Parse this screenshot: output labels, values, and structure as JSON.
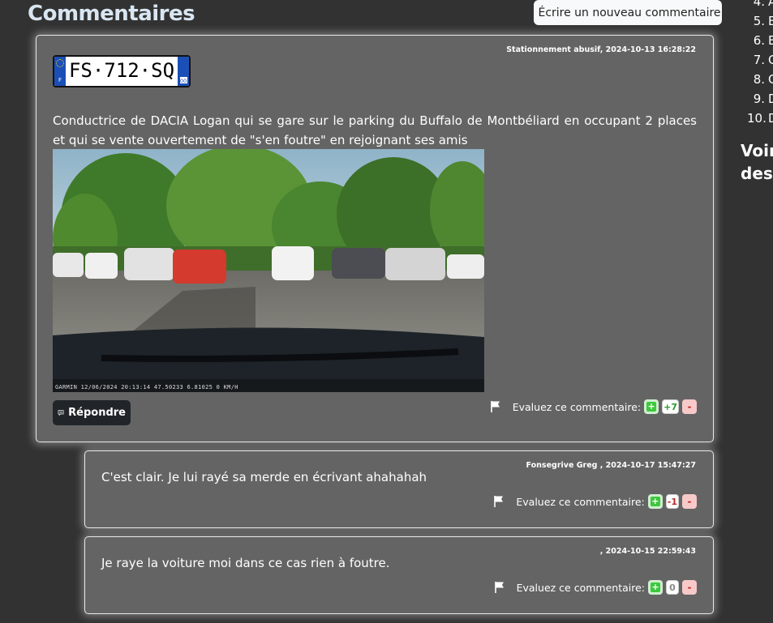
{
  "page": {
    "heading": "Commentaires",
    "write_button_label": "Écrire un nouveau commentaire"
  },
  "sidebar": {
    "items": [
      {
        "num": "4.",
        "text": "A"
      },
      {
        "num": "5.",
        "text": "E"
      },
      {
        "num": "6.",
        "text": "E"
      },
      {
        "num": "7.",
        "text": "G"
      },
      {
        "num": "8.",
        "text": "G"
      },
      {
        "num": "9.",
        "text": "D"
      },
      {
        "num": "10.",
        "text": "D"
      }
    ],
    "heading_line1": "Voir",
    "heading_line2": "des"
  },
  "comments": [
    {
      "meta": "Stationnement abusif, 2024-10-13 16:28:22",
      "plate": {
        "number": "FS·712·SQ",
        "country": "F",
        "department": "00"
      },
      "text": "Conductrice de DACIA Logan qui se gare sur le parking du Buffalo de Montbéliard en occupant 2 places et qui se vente ouvertement de \"s'en foutre\" en rejoignant ses amis",
      "photo_caption": "GARMIN  12/06/2024 20:13:14  47.50233 6.81025  0 KM/H",
      "reply_label": "Répondre",
      "rating_label": "Evaluez ce commentaire:",
      "plus": "+",
      "score": "+7",
      "minus": "-"
    },
    {
      "meta": "Fonsegrive Greg , 2024-10-17 15:47:27",
      "text": "C'est clair. Je lui rayé sa merde en écrivant ahahahah",
      "rating_label": "Evaluez ce commentaire:",
      "plus": "+",
      "score": "-1",
      "minus": "-"
    },
    {
      "meta": ", 2024-10-15 22:59:43",
      "text": "Je raye la voiture moi dans ce cas rien à foutre.",
      "rating_label": "Evaluez ce commentaire:",
      "plus": "+",
      "score": "0",
      "minus": "-"
    }
  ]
}
